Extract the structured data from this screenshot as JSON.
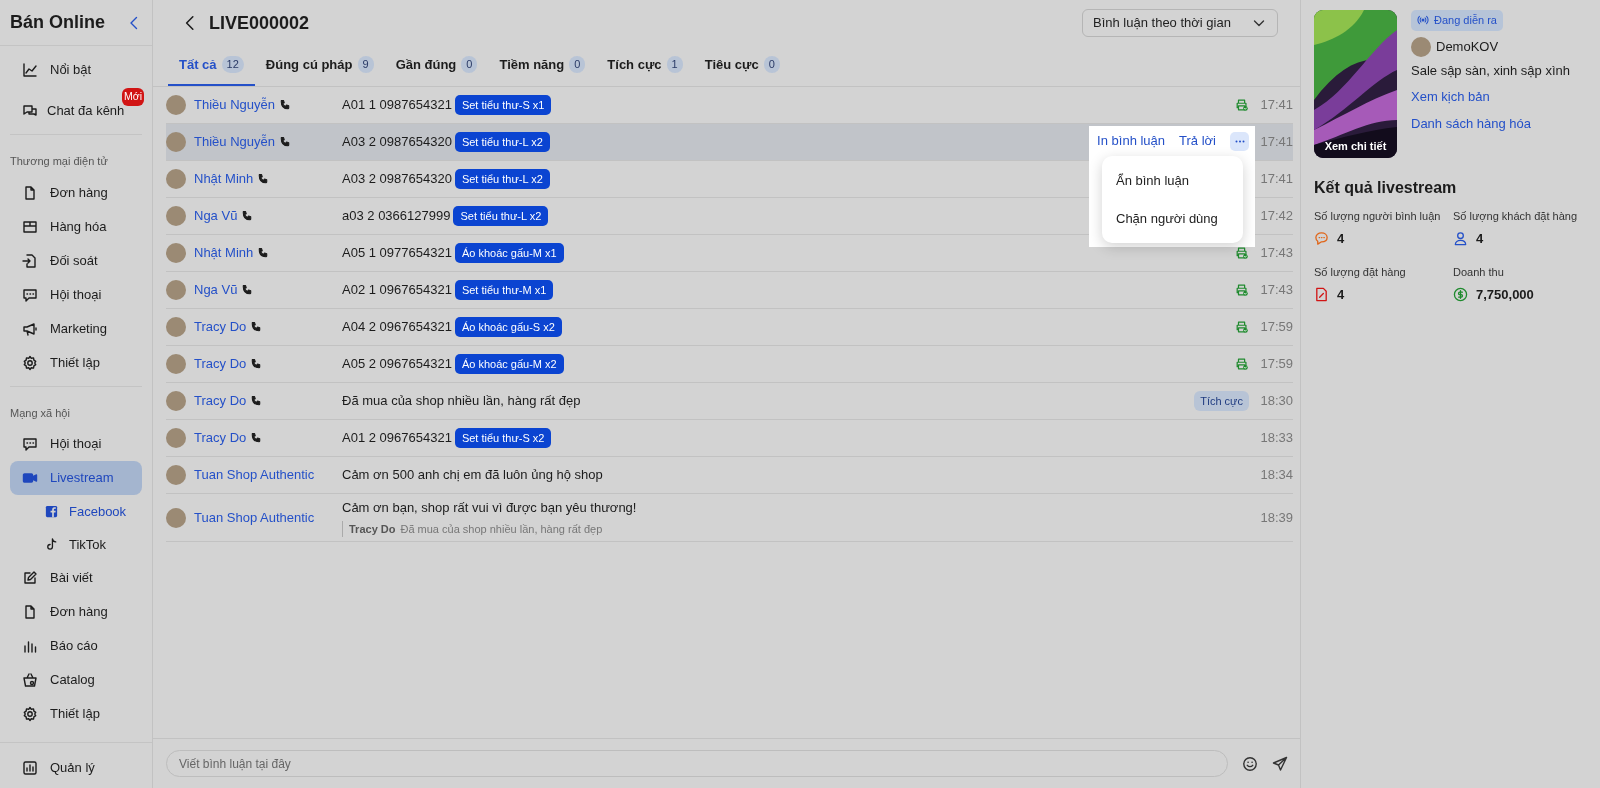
{
  "sidebar": {
    "title": "Bán Online",
    "groups": [
      {
        "items": [
          {
            "kind": "chart",
            "label": "Nổi bật",
            "selected": false
          },
          {
            "kind": "chats",
            "label": "Chat đa kênh",
            "badge": "Mới",
            "selected": false
          }
        ]
      },
      {
        "heading": "Thương mại điện tử",
        "items": [
          {
            "kind": "file",
            "label": "Đơn hàng",
            "selected": false
          },
          {
            "kind": "box",
            "label": "Hàng hóa",
            "selected": false
          },
          {
            "kind": "import",
            "label": "Đối soát",
            "selected": false
          },
          {
            "kind": "message",
            "label": "Hội thoại",
            "selected": false
          },
          {
            "kind": "megaphone",
            "label": "Marketing",
            "selected": false
          },
          {
            "kind": "gear",
            "label": "Thiết lập",
            "selected": false
          }
        ]
      },
      {
        "heading": "Mạng xã hội",
        "items": [
          {
            "kind": "message",
            "label": "Hội thoại",
            "selected": false
          },
          {
            "kind": "video",
            "label": "Livestream",
            "selected": true,
            "children": [
              {
                "kind": "facebook",
                "label": "Facebook",
                "selected": true
              },
              {
                "kind": "tiktok",
                "label": "TikTok",
                "selected": false
              }
            ]
          },
          {
            "kind": "edit",
            "label": "Bài viết",
            "selected": false
          },
          {
            "kind": "file",
            "label": "Đơn hàng",
            "selected": false
          },
          {
            "kind": "bars",
            "label": "Báo cáo",
            "selected": false
          },
          {
            "kind": "basket",
            "label": "Catalog",
            "selected": false
          },
          {
            "kind": "gear",
            "label": "Thiết lập",
            "selected": false
          }
        ]
      }
    ],
    "footer_items": [
      {
        "kind": "report",
        "label": "Quản lý",
        "selected": false
      }
    ]
  },
  "title": "LIVE000002",
  "sort": {
    "value": "Bình luận theo thời gian"
  },
  "tabs": [
    {
      "label": "Tất cả",
      "count": "12",
      "selected": true
    },
    {
      "label": "Đúng cú pháp",
      "count": "9",
      "selected": false
    },
    {
      "label": "Gần đúng",
      "count": "0",
      "selected": false
    },
    {
      "label": "Tiềm năng",
      "count": "0",
      "selected": false
    },
    {
      "label": "Tích cực",
      "count": "1",
      "selected": false
    },
    {
      "label": "Tiêu cực",
      "count": "0",
      "selected": false
    }
  ],
  "comments": [
    {
      "author": "Thiều Nguyễn",
      "phone": true,
      "text": "A01 1 0987654321",
      "product": "Set tiểu thư-S x1",
      "printed": true,
      "time": "17:41",
      "hovered": false
    },
    {
      "author": "Thiều Nguyễn",
      "phone": true,
      "text": "A03 2 0987654320",
      "product": "Set tiểu thư-L x2",
      "printed": false,
      "time": "17:41",
      "hovered": true,
      "actions": [
        "In bình luận",
        "Trả lời"
      ],
      "menu": [
        "Ẩn bình luận",
        "Chặn người dùng"
      ]
    },
    {
      "author": "Nhật Minh",
      "phone": true,
      "text": "A03 2 0987654320",
      "product": "Set tiểu thư-L x2",
      "printed": false,
      "time": "17:41",
      "hovered": false
    },
    {
      "author": "Nga Vũ",
      "phone": true,
      "text": "a03 2 0366127999",
      "product": "Set tiểu thư-L x2",
      "printed": false,
      "time": "17:42",
      "hovered": false
    },
    {
      "author": "Nhật Minh",
      "phone": true,
      "text": "A05 1 0977654321",
      "product": "Áo khoác gấu-M x1",
      "printed": true,
      "time": "17:43",
      "hovered": false
    },
    {
      "author": "Nga Vũ",
      "phone": true,
      "text": "A02 1 0967654321",
      "product": "Set tiểu thư-M x1",
      "printed": true,
      "time": "17:43",
      "hovered": false
    },
    {
      "author": "Tracy Do",
      "phone": true,
      "text": "A04 2 0967654321",
      "product": "Áo khoác gấu-S x2",
      "printed": true,
      "time": "17:59",
      "hovered": false
    },
    {
      "author": "Tracy Do",
      "phone": true,
      "text": "A05 2 0967654321",
      "product": "Áo khoác gấu-M x2",
      "printed": true,
      "time": "17:59",
      "hovered": false
    },
    {
      "author": "Tracy Do",
      "phone": true,
      "text": "Đã mua của shop nhiều lần, hàng rất đẹp",
      "sentiment": "Tích cực",
      "printed": false,
      "time": "18:30",
      "hovered": false
    },
    {
      "author": "Tracy Do",
      "phone": true,
      "text": "A01 2 0967654321",
      "product": "Set tiểu thư-S x2",
      "printed": false,
      "time": "18:33",
      "hovered": false
    },
    {
      "author": "Tuan Shop Authentic",
      "phone": false,
      "text": "Cảm ơn 500 anh chị em đã luôn ủng hộ shop",
      "printed": false,
      "time": "18:34",
      "hovered": false
    },
    {
      "author": "Tuan Shop Authentic",
      "phone": false,
      "text": "Cảm ơn bạn, shop rất vui vì được bạn yêu thương!",
      "reply": {
        "author": "Tracy Do",
        "text": "Đã mua của shop nhiều lần, hàng rất đẹp"
      },
      "printed": false,
      "time": "18:39",
      "hovered": false
    }
  ],
  "composer": {
    "placeholder": "Viết bình luận tại đây"
  },
  "live": {
    "thumbnail": {
      "kind": "picture",
      "caption": "Xem chi tiết"
    },
    "status": "Đang diễn ra",
    "host": "DemoKOV",
    "headline": "Sale sập sàn, xinh sập xình",
    "links": [
      "Xem kịch bản",
      "Danh sách hàng hóa"
    ]
  },
  "results": {
    "title": "Kết quả livestream",
    "stats": [
      {
        "kind": "comment",
        "label": "Số lượng người bình luận",
        "value": "4"
      },
      {
        "kind": "person",
        "label": "Số lượng khách đặt hàng",
        "value": "4"
      },
      {
        "kind": "order",
        "label": "Số lượng đặt hàng",
        "value": "4"
      },
      {
        "kind": "money",
        "label": "Doanh thu",
        "value": "7,750,000"
      }
    ]
  }
}
